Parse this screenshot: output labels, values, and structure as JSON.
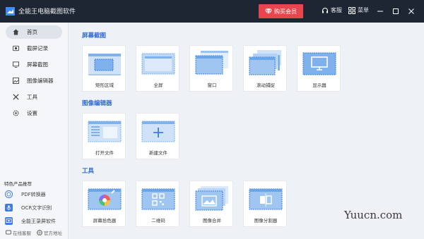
{
  "app": {
    "title": "全能王电脑截图软件"
  },
  "header": {
    "vip_label": "购买会员",
    "support_label": "客服",
    "menu_label": "菜单"
  },
  "sidebar": {
    "items": [
      {
        "label": "首页",
        "icon": "home-icon",
        "active": true
      },
      {
        "label": "截屏记录",
        "icon": "record-icon"
      },
      {
        "label": "屏幕截图",
        "icon": "screenshot-icon"
      },
      {
        "label": "图像编辑器",
        "icon": "image-editor-icon"
      },
      {
        "label": "工具",
        "icon": "tools-icon"
      },
      {
        "label": "设置",
        "icon": "settings-icon"
      }
    ],
    "recommend_title": "特色产品推荐",
    "recommend": [
      {
        "label": "PDF转换器",
        "color": "#3d7be6"
      },
      {
        "label": "OCR文字识别",
        "color": "#3d7be6"
      },
      {
        "label": "全能王录屏软件",
        "color": "#3d7be6"
      }
    ],
    "online_support": "在线客服",
    "official_site": "官方地址"
  },
  "sections": {
    "screenshot": {
      "title": "屏幕截图",
      "tiles": [
        "矩形区域",
        "全屏",
        "窗口",
        "滚动捕捉",
        "显示器"
      ]
    },
    "editor": {
      "title": "图像编辑器",
      "tiles": [
        "打开文件",
        "新建文件"
      ]
    },
    "tools": {
      "title": "工具",
      "tiles": [
        "屏幕拾色器",
        "二维码",
        "图像合并",
        "图像分割器"
      ]
    }
  },
  "colors": {
    "accent": "#2f6bd6",
    "vip": "#e8454d",
    "titlebar": "#1f2633",
    "tile_blue": "#7fb2ec"
  },
  "watermark": "Yuucn.com"
}
